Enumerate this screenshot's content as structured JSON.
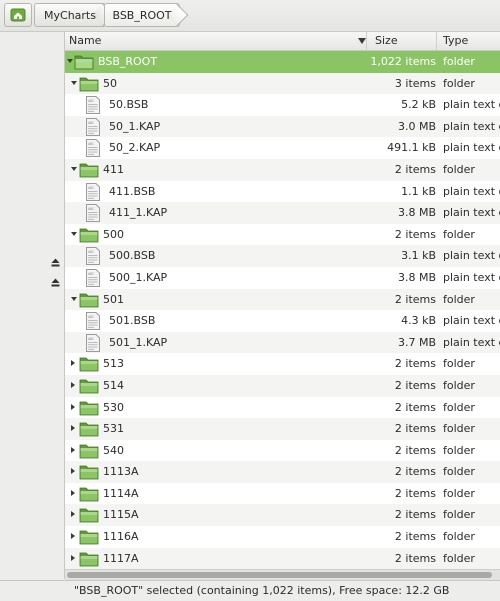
{
  "breadcrumb": {
    "items": [
      {
        "label": "MyCharts"
      },
      {
        "label": "BSB_ROOT"
      }
    ]
  },
  "columns": {
    "name": "Name",
    "size": "Size",
    "type": "Type"
  },
  "colors": {
    "selection": "#8bc465",
    "folder_green": "#7dbb4f",
    "alt_row": "#f4f4f2"
  },
  "rows": [
    {
      "name": "BSB_ROOT",
      "size": "1,022 items",
      "type": "folder",
      "kind": "folder",
      "level": 0,
      "expander": "open",
      "selected": true
    },
    {
      "name": "50",
      "size": "3 items",
      "type": "folder",
      "kind": "folder",
      "level": 1,
      "expander": "open"
    },
    {
      "name": "50.BSB",
      "size": "5.2 kB",
      "type": "plain text d",
      "kind": "file",
      "level": 2
    },
    {
      "name": "50_1.KAP",
      "size": "3.0 MB",
      "type": "plain text d",
      "kind": "file",
      "level": 2
    },
    {
      "name": "50_2.KAP",
      "size": "491.1 kB",
      "type": "plain text d",
      "kind": "file",
      "level": 2
    },
    {
      "name": "411",
      "size": "2 items",
      "type": "folder",
      "kind": "folder",
      "level": 1,
      "expander": "open"
    },
    {
      "name": "411.BSB",
      "size": "1.1 kB",
      "type": "plain text d",
      "kind": "file",
      "level": 2
    },
    {
      "name": "411_1.KAP",
      "size": "3.8 MB",
      "type": "plain text d",
      "kind": "file",
      "level": 2
    },
    {
      "name": "500",
      "size": "2 items",
      "type": "folder",
      "kind": "folder",
      "level": 1,
      "expander": "open"
    },
    {
      "name": "500.BSB",
      "size": "3.1 kB",
      "type": "plain text d",
      "kind": "file",
      "level": 2
    },
    {
      "name": "500_1.KAP",
      "size": "3.8 MB",
      "type": "plain text d",
      "kind": "file",
      "level": 2
    },
    {
      "name": "501",
      "size": "2 items",
      "type": "folder",
      "kind": "folder",
      "level": 1,
      "expander": "open"
    },
    {
      "name": "501.BSB",
      "size": "4.3 kB",
      "type": "plain text d",
      "kind": "file",
      "level": 2
    },
    {
      "name": "501_1.KAP",
      "size": "3.7 MB",
      "type": "plain text d",
      "kind": "file",
      "level": 2
    },
    {
      "name": "513",
      "size": "2 items",
      "type": "folder",
      "kind": "folder",
      "level": 1,
      "expander": "closed"
    },
    {
      "name": "514",
      "size": "2 items",
      "type": "folder",
      "kind": "folder",
      "level": 1,
      "expander": "closed"
    },
    {
      "name": "530",
      "size": "2 items",
      "type": "folder",
      "kind": "folder",
      "level": 1,
      "expander": "closed"
    },
    {
      "name": "531",
      "size": "2 items",
      "type": "folder",
      "kind": "folder",
      "level": 1,
      "expander": "closed"
    },
    {
      "name": "540",
      "size": "2 items",
      "type": "folder",
      "kind": "folder",
      "level": 1,
      "expander": "closed"
    },
    {
      "name": "1113A",
      "size": "2 items",
      "type": "folder",
      "kind": "folder",
      "level": 1,
      "expander": "closed"
    },
    {
      "name": "1114A",
      "size": "2 items",
      "type": "folder",
      "kind": "folder",
      "level": 1,
      "expander": "closed"
    },
    {
      "name": "1115A",
      "size": "2 items",
      "type": "folder",
      "kind": "folder",
      "level": 1,
      "expander": "closed"
    },
    {
      "name": "1116A",
      "size": "2 items",
      "type": "folder",
      "kind": "folder",
      "level": 1,
      "expander": "closed"
    },
    {
      "name": "1117A",
      "size": "2 items",
      "type": "folder",
      "kind": "folder",
      "level": 1,
      "expander": "closed"
    }
  ],
  "status": {
    "text": "\"BSB_ROOT\" selected (containing 1,022 items), Free space: 12.2 GB"
  },
  "icons": {
    "home": "home-icon",
    "folder": "folder-icon",
    "file": "text-file-icon",
    "eject": "eject-icon"
  }
}
